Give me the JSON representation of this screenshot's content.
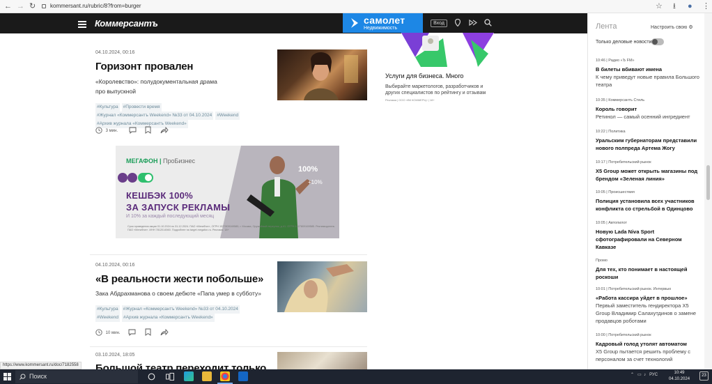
{
  "browser": {
    "url": "kommersant.ru/rubric/8?from=burger",
    "nav_back": "←",
    "nav_forward": "→",
    "nav_reload": "↻",
    "star": "☆",
    "download": "⭳",
    "profile": "●",
    "menu": "⋮"
  },
  "site": {
    "logo": "Коммерсантъ",
    "promo_name": "самолет",
    "promo_sub": "Недвижимость",
    "login": "Вход",
    "accent": "#1d87e5"
  },
  "articles": [
    {
      "date": "04.10.2024, 00:16",
      "title": "Горизонт провален",
      "lead_1": "«Королевство»: полудокументальная драма",
      "lead_2": "про выпускной",
      "tags": [
        "#Культура",
        "#Провести время",
        "#Журнал «Коммерсантъ Weekend» №33 от 04.10.2024",
        "#Weekend",
        "#Архив журнала «Коммерсантъ Weekend»"
      ],
      "read_time": "3 мин."
    },
    {
      "date": "04.10.2024, 00:16",
      "title": "«В реальности жести побольше»",
      "lead_1": "Зака Абдрахманова о своем дебюте «Папа умер в субботу»",
      "tags": [
        "#Культура",
        "#Журнал «Коммерсантъ Weekend» №33 от 04.10.2024",
        "#Weekend",
        "#Архив журнала «Коммерсантъ Weekend»"
      ],
      "read_time": "10 мин."
    },
    {
      "date": "03.10.2024, 18:05",
      "title": "Большой театр переходит только"
    }
  ],
  "banner": {
    "brand": "МЕГАФОН",
    "brand_sub": "ПроБизнес",
    "line1": "КЕШБЭК 100%",
    "line2": "ЗА ЗАПУСК РЕКЛАМЫ",
    "line3": "И 10% за каждый последующий месяц",
    "pct": "100%",
    "pct2": "+10%",
    "fine": "Срок проведения акции 01.10.2024 по 31.12.2024. ПАО «МегаФон», ОГРН 1027809169585, г. Москва, Оружейный переулок, д.41. ОГРН 1027809169585. Рекламодатель ПАО «МегаФон». ИНН 7812014560. Подробнее на target.megafon.ru. Реклама. 18+"
  },
  "ad": {
    "title": "Услуги для бизнеса. Много",
    "text": "Выбирайте маркетологов, разработчиков и других специалистов по рейтингу и отзывам",
    "legal": "Реклама | ООО «ВК КОММЕРЦ» | 18+"
  },
  "feed": {
    "title": "Лента",
    "settings": "Настроить свою",
    "toggle_label": "Только деловые новости",
    "items": [
      {
        "meta": "10:46  |  Радио «Ъ FM»",
        "title": "В билеты вбивают имена",
        "lead": "К чему приведут новые правила Большого театра"
      },
      {
        "meta": "10:35  |  Коммерсантъ Стиль",
        "title": "Король говорит",
        "lead": "Ретинол — самый осенний ингредиент"
      },
      {
        "meta": "10:22  |  Политика",
        "title": "Уральским губернаторам представили нового полпреда Артема Жогу",
        "lead": ""
      },
      {
        "meta": "10:17  |  Потребительский рынок",
        "title": "X5 Group может открыть магазины под брендом «Зеленая линия»",
        "lead": ""
      },
      {
        "meta": "10:05  |  Происшествия",
        "title": "Полиция установила всех участников конфликта со стрельбой в Одинцово",
        "lead": ""
      },
      {
        "meta": "10:05  |  Автопилот",
        "title": "Новую Lada Niva Sport сфотографировали на Северном Кавказе",
        "lead": ""
      },
      {
        "meta": "Промо",
        "title": "Для тех, кто понимает в настоящей роскоши",
        "lead": ""
      },
      {
        "meta": "10:01  |  Потребительский рынок. Интервью",
        "title": "«Работа кассира уйдет в прошлое»",
        "lead": "Первый заместитель гендиректора X5 Group Владимир Салахутдинов о замене продавцов роботами"
      },
      {
        "meta": "10:00  |  Потребительский рынок",
        "title": "Кадровый голод утолят автоматом",
        "lead": "X5 Group пытается решить проблему с персоналом за счет технологий"
      }
    ]
  },
  "status_url": "https://www.kommersant.ru/doc/7182558",
  "taskbar": {
    "search": "Поиск",
    "lang": "РУС",
    "time": "10:49",
    "date": "04.10.2024",
    "notif": "23"
  }
}
